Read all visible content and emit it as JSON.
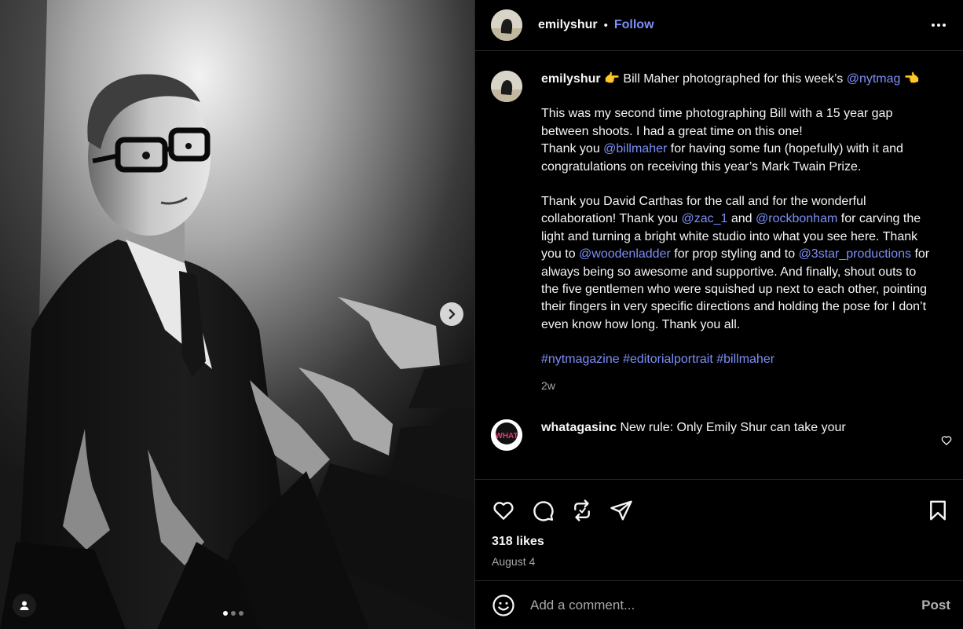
{
  "post": {
    "username": "emilyshur",
    "separator": "•",
    "follow_label": "Follow",
    "more_icon": "more-horizontal-icon"
  },
  "caption": {
    "username": "emilyshur",
    "line1_pre": "👉 Bill Maher photographed for this week’s ",
    "line1_mention": "@nytmag",
    "line1_post": " 👈",
    "p2_a": "This was my second time photographing Bill with a 15 year gap between shoots. I had a great time on this one!",
    "p2_b_pre": "Thank you ",
    "p2_b_mention": "@billmaher",
    "p2_b_post": " for having some fun (hopefully) with it and congratulations on receiving this year’s Mark Twain Prize.",
    "p3_1": "Thank you David Carthas for the call and for the wonderful collaboration! Thank you ",
    "p3_m1": "@zac_1",
    "p3_2": " and ",
    "p3_m2": "@rockbonham",
    "p3_3": " for carving the light and turning a bright white studio into what you see here. Thank you to ",
    "p3_m3": "@woodenladder",
    "p3_4": " for prop styling and to ",
    "p3_m4": "@3star_productions",
    "p3_5": " for always being so awesome and supportive. And finally, shout outs to the five gentlemen who were squished up next to each other, pointing their fingers in very specific directions and holding the pose for I don’t even know how long. Thank you all.",
    "hashtags": "#nytmagazine #editorialportrait #billmaher",
    "time": "2w"
  },
  "comment": {
    "username": "whatagasinc",
    "avatar_text": "WHAT",
    "text": " New rule: Only Emily Shur can take your"
  },
  "actions": {
    "likes": "318 likes",
    "date": "August 4"
  },
  "comment_box": {
    "placeholder": "Add a comment...",
    "post_label": "Post"
  },
  "colors": {
    "accent": "#7d8ff8",
    "background": "#000000",
    "secondary_text": "#a8a8a8"
  }
}
